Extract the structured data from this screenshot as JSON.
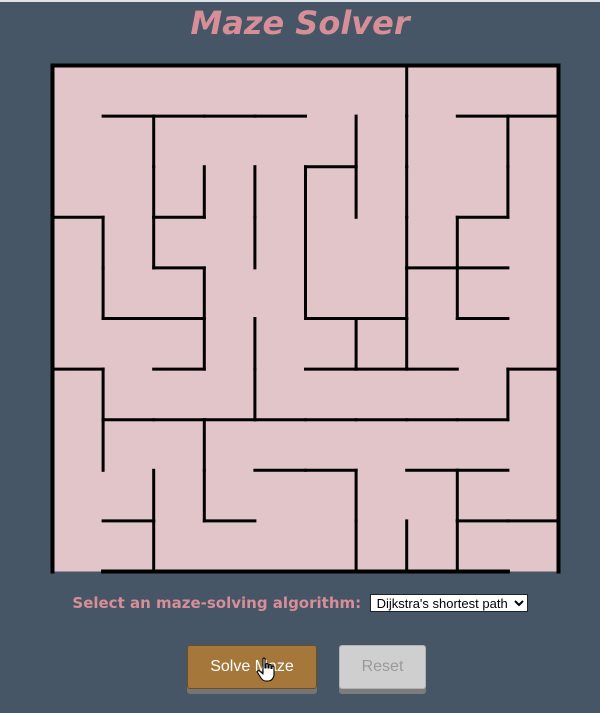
{
  "title": "Maze Solver",
  "controls": {
    "algorithm_label": "Select an maze-solving algorithm:",
    "algorithm_selected": "Dijkstra's shortest path",
    "solve_label": "Solve Maze",
    "reset_label": "Reset"
  },
  "maze": {
    "rows": 10,
    "cols": 10,
    "background_color": "#e2c5c9",
    "wall_color": "#000000",
    "horizontal_walls": [
      [
        1,
        1,
        1,
        1,
        1,
        1,
        1,
        1,
        1,
        1
      ],
      [
        0,
        1,
        1,
        1,
        1,
        0,
        0,
        0,
        1,
        1
      ],
      [
        0,
        0,
        0,
        0,
        0,
        1,
        0,
        0,
        0,
        0
      ],
      [
        1,
        0,
        1,
        0,
        0,
        0,
        0,
        0,
        1,
        0
      ],
      [
        0,
        0,
        1,
        0,
        0,
        0,
        0,
        1,
        1,
        0
      ],
      [
        0,
        1,
        1,
        0,
        0,
        1,
        1,
        0,
        1,
        0
      ],
      [
        1,
        0,
        1,
        0,
        0,
        1,
        1,
        1,
        0,
        1
      ],
      [
        0,
        1,
        1,
        1,
        1,
        1,
        1,
        1,
        1,
        0
      ],
      [
        0,
        0,
        0,
        0,
        1,
        1,
        0,
        1,
        1,
        0
      ],
      [
        0,
        1,
        0,
        1,
        0,
        0,
        0,
        0,
        1,
        1
      ],
      [
        0,
        1,
        1,
        1,
        1,
        1,
        1,
        1,
        1,
        0
      ]
    ],
    "vertical_walls": [
      [
        1,
        0,
        0,
        0,
        0,
        0,
        0,
        1,
        0,
        0,
        1
      ],
      [
        1,
        0,
        1,
        0,
        0,
        0,
        1,
        1,
        0,
        1,
        1
      ],
      [
        1,
        0,
        1,
        1,
        1,
        1,
        1,
        1,
        0,
        1,
        1
      ],
      [
        1,
        1,
        1,
        0,
        1,
        1,
        0,
        1,
        1,
        0,
        1
      ],
      [
        1,
        1,
        0,
        1,
        0,
        1,
        0,
        1,
        1,
        0,
        1
      ],
      [
        1,
        0,
        0,
        1,
        1,
        0,
        1,
        1,
        0,
        0,
        1
      ],
      [
        1,
        1,
        0,
        0,
        1,
        0,
        0,
        0,
        0,
        1,
        1
      ],
      [
        1,
        1,
        0,
        1,
        0,
        0,
        0,
        0,
        0,
        0,
        1
      ],
      [
        1,
        0,
        1,
        1,
        0,
        0,
        1,
        0,
        1,
        0,
        1
      ],
      [
        1,
        0,
        1,
        0,
        0,
        0,
        1,
        1,
        1,
        0,
        1
      ]
    ]
  }
}
